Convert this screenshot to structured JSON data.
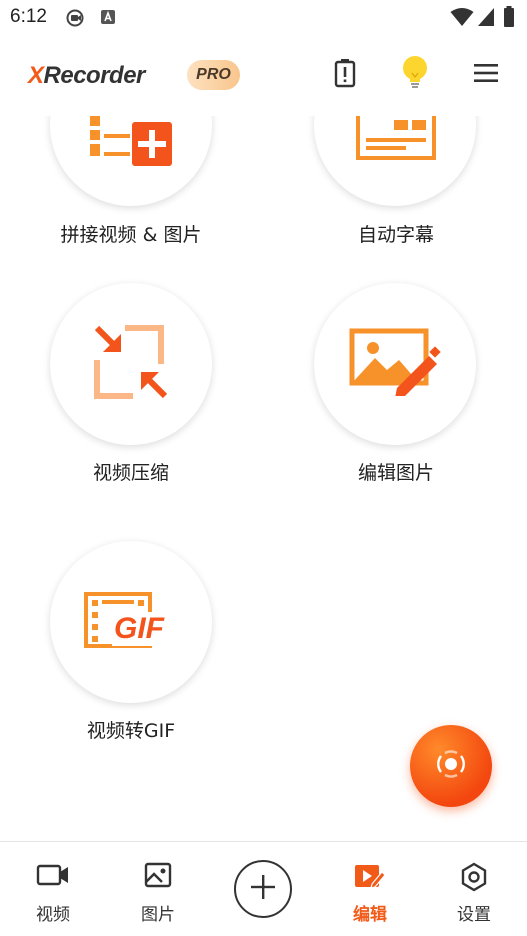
{
  "status_bar": {
    "time": "6:12",
    "icons": [
      "camera-record-icon",
      "a-notification-icon",
      "wifi-icon",
      "cellular-signal-icon",
      "battery-icon"
    ]
  },
  "header": {
    "logo_x": "X",
    "logo_rest": "Recorder",
    "pro_badge": "PRO",
    "icons": [
      "battery-alert-icon",
      "lightbulb-icon",
      "menu-icon"
    ]
  },
  "tools": [
    {
      "label": "拼接视频 & 图片",
      "icon": "merge-video-image-icon"
    },
    {
      "label": "自动字幕",
      "icon": "auto-subtitle-icon"
    },
    {
      "label": "视频压缩",
      "icon": "compress-icon"
    },
    {
      "label": "编辑图片",
      "icon": "edit-image-icon"
    },
    {
      "label": "视频转GIF",
      "icon": "video-to-gif-icon",
      "icon_text": "GIF"
    }
  ],
  "fab": {
    "icon": "record-icon"
  },
  "bottom_nav": {
    "items": [
      {
        "label": "视频",
        "icon": "video-camera-icon"
      },
      {
        "label": "图片",
        "icon": "image-icon"
      },
      {
        "label": "编辑",
        "icon": "edit-video-icon",
        "active": true
      },
      {
        "label": "设置",
        "icon": "settings-icon"
      }
    ],
    "add_icon": "add-icon"
  },
  "colors": {
    "accent": "#f25a18",
    "accent_light": "#fbb786",
    "text": "#222222"
  }
}
